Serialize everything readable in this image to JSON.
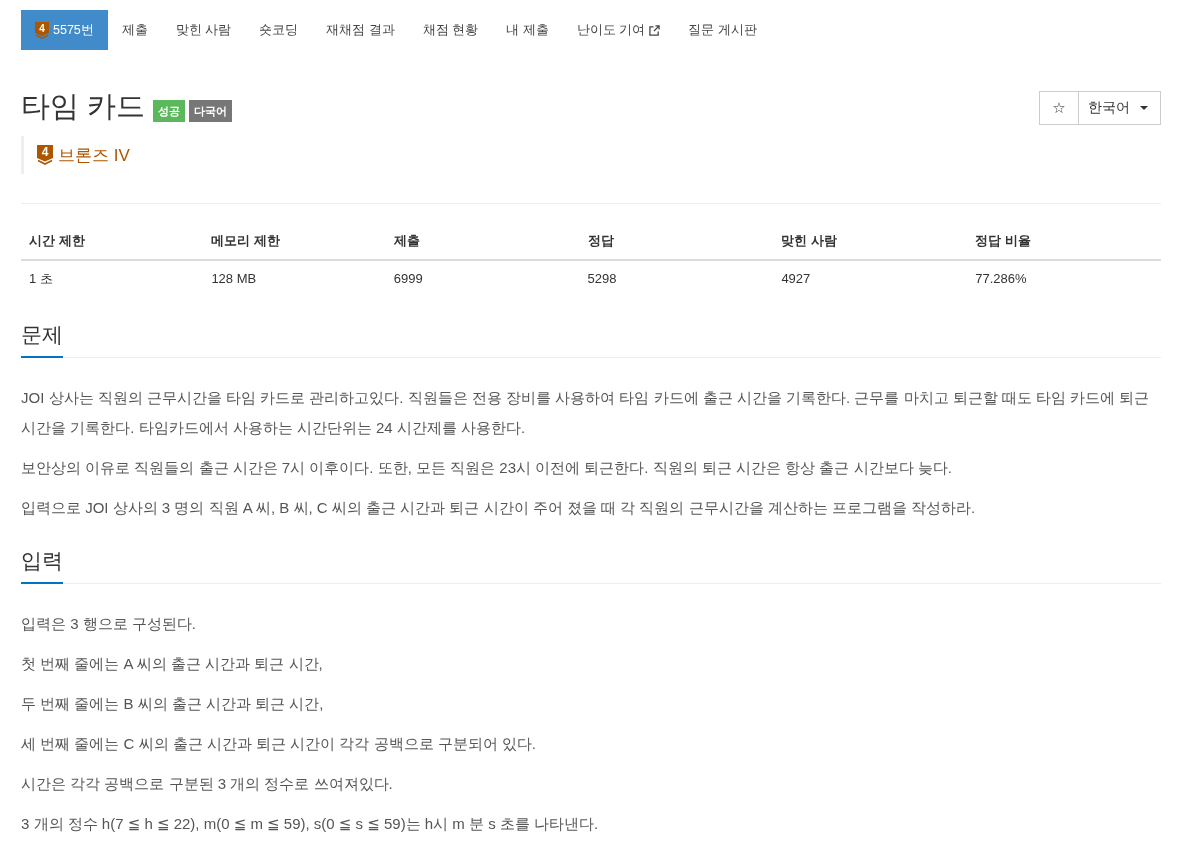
{
  "nav": {
    "items": [
      {
        "label": "5575번",
        "badge": "4",
        "selected": true,
        "external": false
      },
      {
        "label": "제출",
        "selected": false,
        "external": false
      },
      {
        "label": "맞힌 사람",
        "selected": false,
        "external": false
      },
      {
        "label": "숏코딩",
        "selected": false,
        "external": false
      },
      {
        "label": "재채점 결과",
        "selected": false,
        "external": false
      },
      {
        "label": "채점 현황",
        "selected": false,
        "external": false
      },
      {
        "label": "내 제출",
        "selected": false,
        "external": false
      },
      {
        "label": "난이도 기여",
        "selected": false,
        "external": true
      },
      {
        "label": "질문 게시판",
        "selected": false,
        "external": false
      }
    ]
  },
  "title": "타임 카드",
  "labels": [
    {
      "text": "성공",
      "color": "#5cb85c"
    },
    {
      "text": "다국어",
      "color": "#777777"
    }
  ],
  "tier": {
    "badge": "4",
    "text": "브론즈 IV"
  },
  "toolbar": {
    "star": "☆",
    "language": "한국어"
  },
  "stats": {
    "columns": [
      "시간 제한",
      "메모리 제한",
      "제출",
      "정답",
      "맞힌 사람",
      "정답 비율"
    ],
    "rows": [
      [
        "1 초",
        "128 MB",
        "6999",
        "5298",
        "4927",
        "77.286%"
      ]
    ]
  },
  "sections": [
    {
      "heading": "문제",
      "paragraphs": [
        "JOI 상사는 직원의 근무시간을 타임 카드로 관리하고있다. 직원들은 전용 장비를 사용하여 타임 카드에 출근 시간을 기록한다. 근무를 마치고 퇴근할 때도 타임 카드에 퇴근 시간을 기록한다. 타임카드에서 사용하는 시간단위는 24 시간제를 사용한다.",
        "보안상의 이유로 직원들의 출근 시간은 7시 이후이다. 또한, 모든 직원은 23시 이전에 퇴근한다. 직원의 퇴근 시간은 항상 출근 시간보다 늦다.",
        "입력으로 JOI 상사의 3 명의 직원 A 씨, B 씨, C 씨의 출근 시간과 퇴근 시간이 주어 졌을 때 각 직원의 근무시간을 계산하는 프로그램을 작성하라."
      ]
    },
    {
      "heading": "입력",
      "paragraphs": [
        "입력은 3 행으로 구성된다.",
        "첫 번째 줄에는 A 씨의 출근 시간과 퇴근 시간,",
        "두 번째 줄에는 B 씨의 출근 시간과 퇴근 시간,",
        "세 번째 줄에는 C 씨의 출근 시간과 퇴근 시간이 각각 공백으로 구분되어 있다.",
        "시간은 각각 공백으로 구분된 3 개의 정수로 쓰여져있다.",
        "3 개의 정수 h(7 ≦ h ≦ 22), m(0 ≦ m ≦ 59), s(0 ≦ s ≦ 59)는 h시 m 분 s 초를 나타낸다."
      ]
    }
  ]
}
